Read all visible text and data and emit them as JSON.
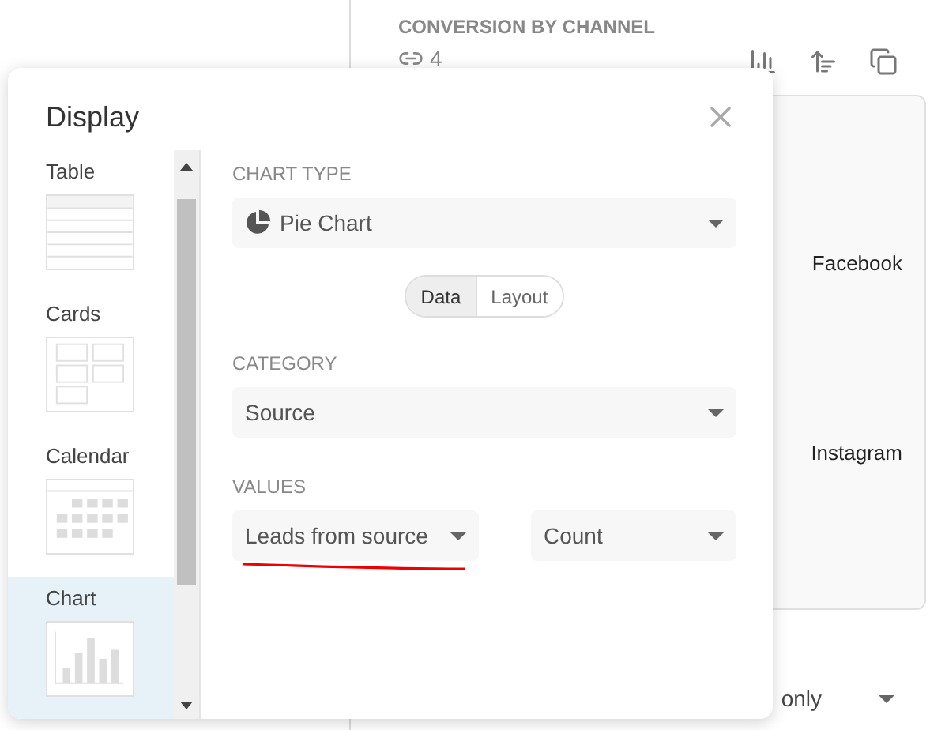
{
  "background": {
    "title": "CONVERSION BY CHANNEL",
    "link_count": "4",
    "chart_labels": [
      "Facebook",
      "Instagram"
    ],
    "filter_value": "only"
  },
  "dialog": {
    "title": "Display",
    "views": [
      {
        "label": "Table",
        "kind": "table",
        "selected": false
      },
      {
        "label": "Cards",
        "kind": "cards",
        "selected": false
      },
      {
        "label": "Calendar",
        "kind": "calendar",
        "selected": false
      },
      {
        "label": "Chart",
        "kind": "chart",
        "selected": true
      }
    ],
    "chart_type": {
      "label": "CHART TYPE",
      "value": "Pie Chart"
    },
    "modes": [
      {
        "label": "Data",
        "selected": true
      },
      {
        "label": "Layout",
        "selected": false
      }
    ],
    "category": {
      "label": "CATEGORY",
      "value": "Source"
    },
    "values": {
      "label": "VALUES",
      "field": "Leads from source",
      "aggregate": "Count"
    }
  }
}
